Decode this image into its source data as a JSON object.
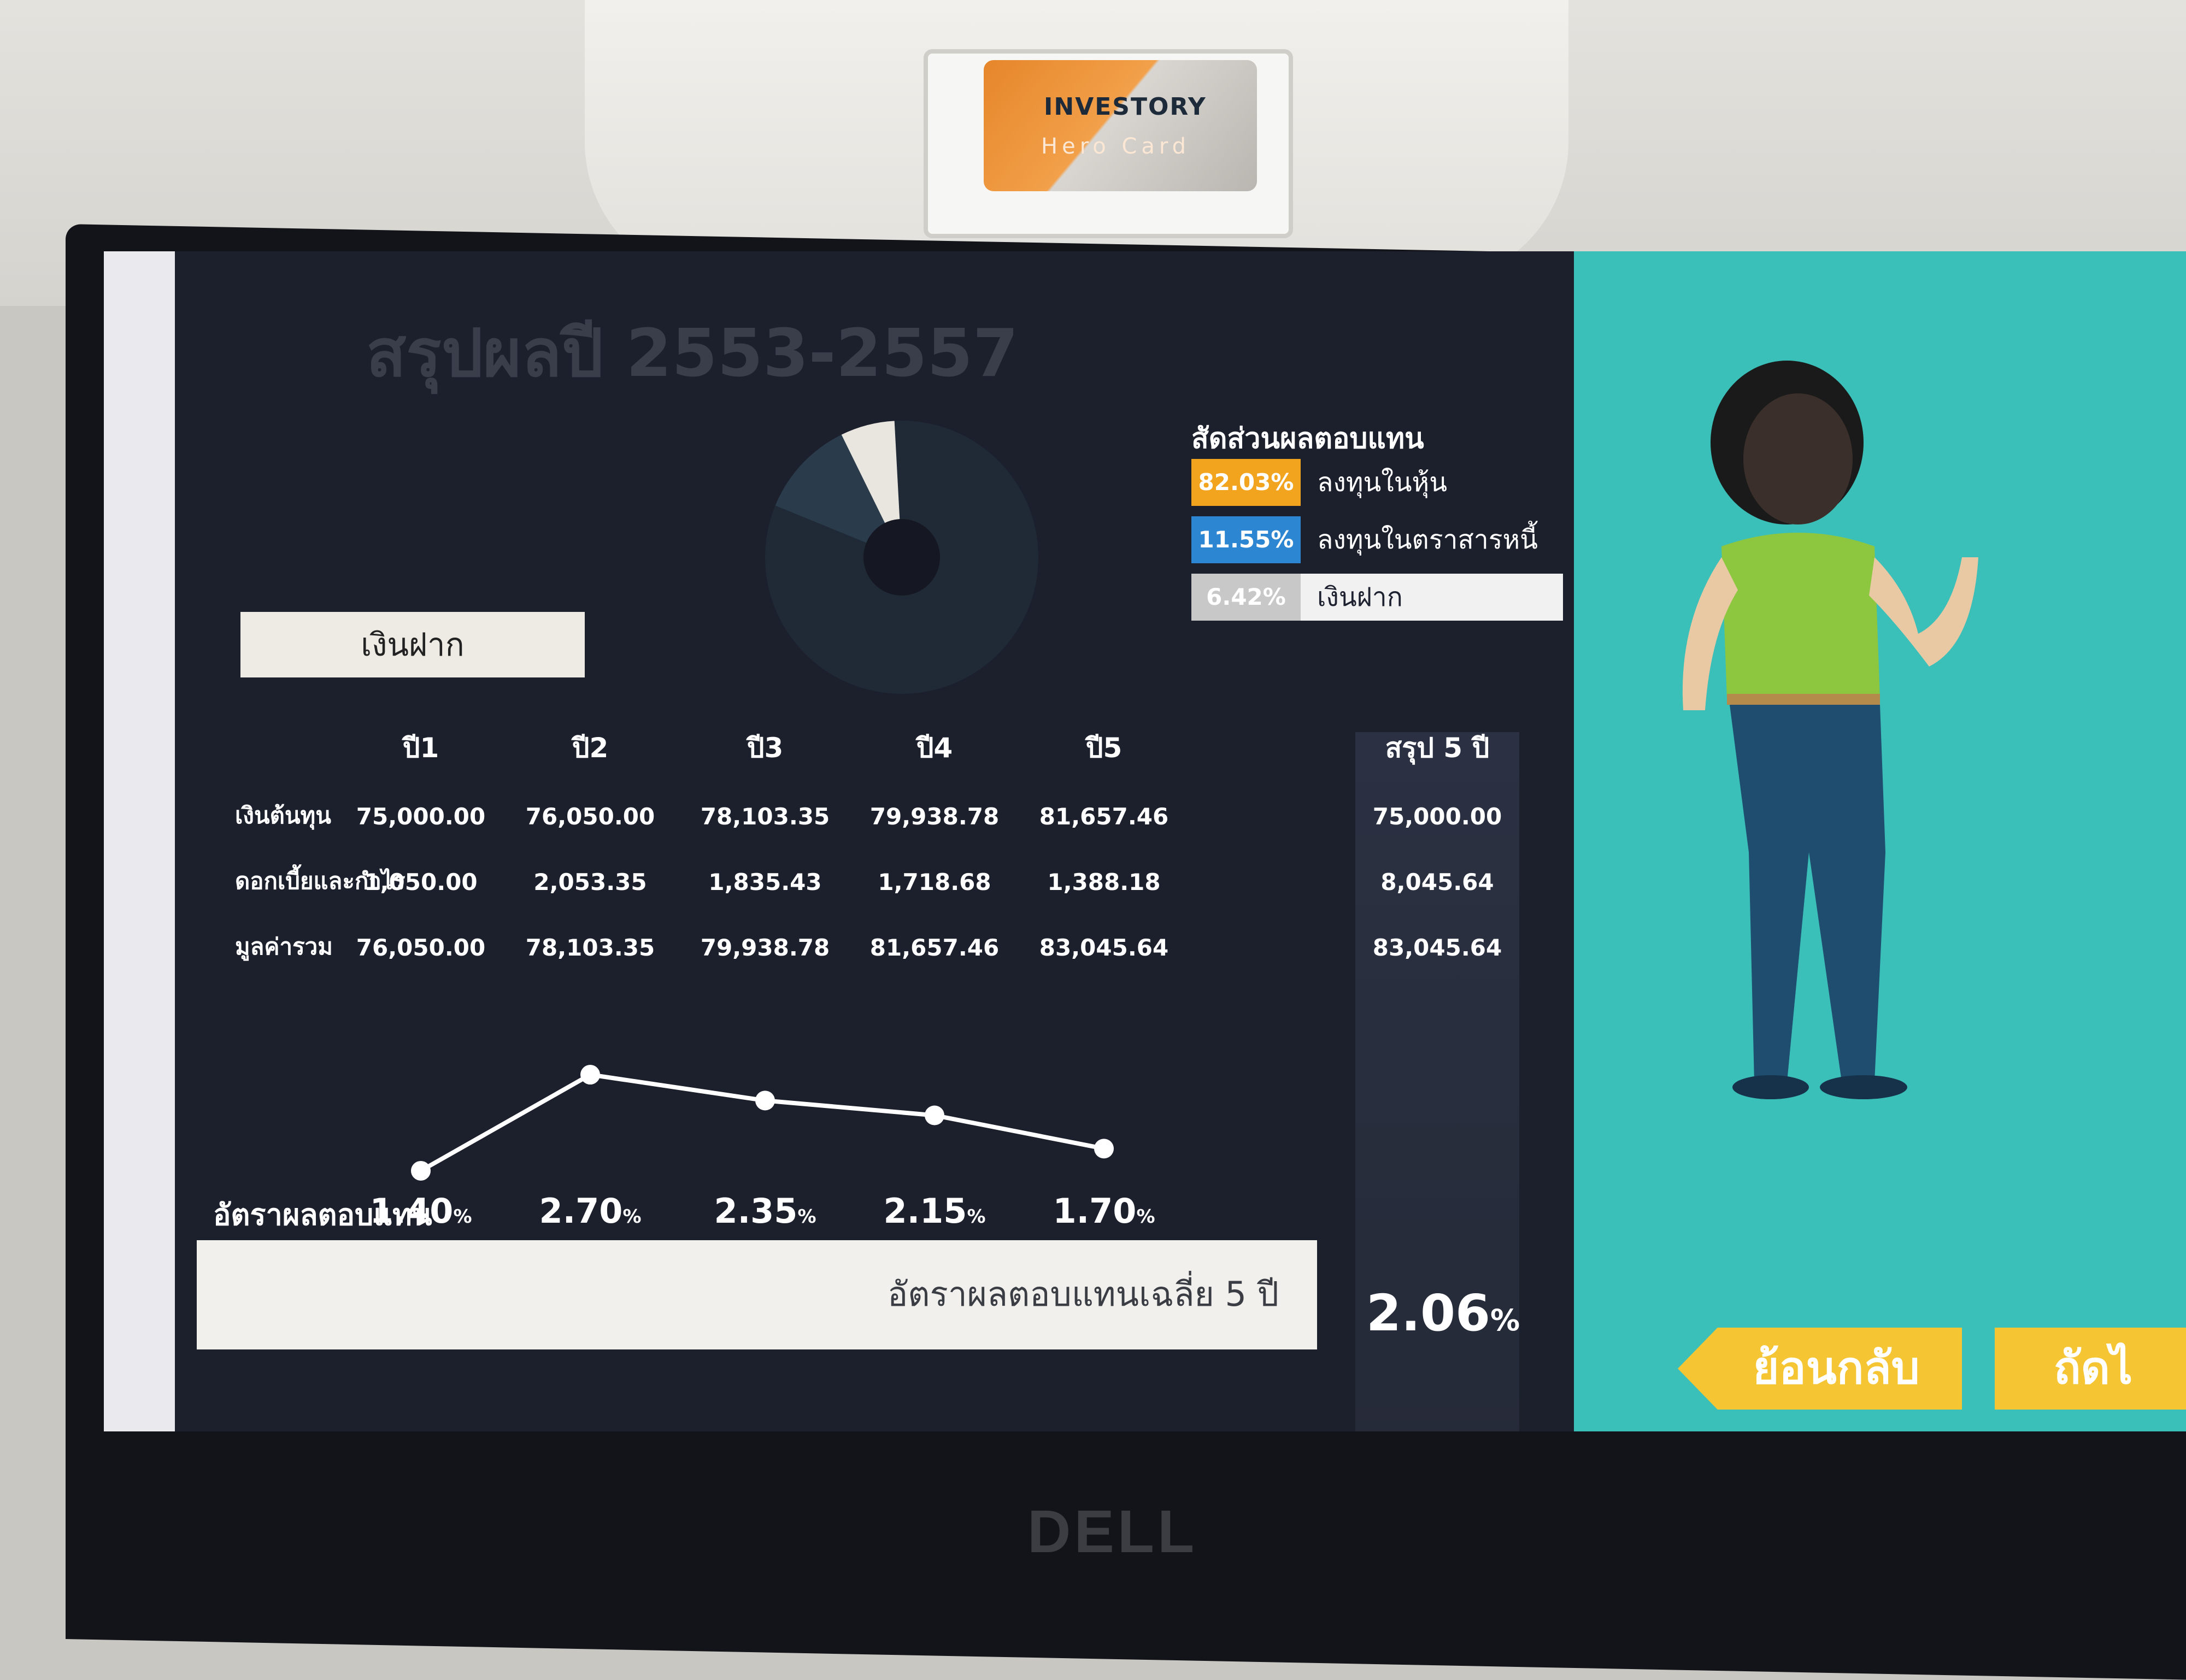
{
  "card": {
    "brand": "INVESTORY",
    "title": "Hero Card"
  },
  "monitor": {
    "brand": "DELL"
  },
  "page": {
    "title": "สรุปผลปี 2553-2557"
  },
  "legend": {
    "title": "สัดส่วนผลตอบแทน",
    "items": [
      {
        "percent": "82.03%",
        "label": "ลงทุนในหุ้น",
        "color": "#f2a41f"
      },
      {
        "percent": "11.55%",
        "label": "ลงทุนในตราสารหนี้",
        "color": "#2c86d1"
      },
      {
        "percent": "6.42%",
        "label": "เงินฝาก",
        "color": "#c8c8c8"
      }
    ]
  },
  "pie": {
    "values": [
      82.03,
      11.55,
      6.42
    ],
    "colors": [
      "#1f2a36",
      "#2a3b4c",
      "#e8e6df"
    ]
  },
  "tab": {
    "label": "เงินฝาก"
  },
  "table": {
    "columns": [
      "ปี1",
      "ปี2",
      "ปี3",
      "ปี4",
      "ปี5",
      "สรุป 5 ปี"
    ],
    "rows": [
      {
        "label": "เงินต้นทุน",
        "values": [
          "75,000.00",
          "76,050.00",
          "78,103.35",
          "79,938.78",
          "81,657.46",
          "75,000.00"
        ]
      },
      {
        "label": "ดอกเบี้ยและกำไร",
        "values": [
          "1,050.00",
          "2,053.35",
          "1,835.43",
          "1,718.68",
          "1,388.18",
          "8,045.64"
        ]
      },
      {
        "label": "มูลค่ารวม",
        "values": [
          "76,050.00",
          "78,103.35",
          "79,938.78",
          "81,657.46",
          "83,045.64",
          "83,045.64"
        ]
      }
    ]
  },
  "rates": {
    "label": "อัตราผลตอบแทน",
    "values": [
      "1.40",
      "2.70",
      "2.35",
      "2.15",
      "1.70"
    ],
    "unit": "%"
  },
  "chart_data": {
    "type": "line",
    "x": [
      "ปี1",
      "ปี2",
      "ปี3",
      "ปี4",
      "ปี5"
    ],
    "values": [
      1.4,
      2.7,
      2.35,
      2.15,
      1.7
    ]
  },
  "average": {
    "label": "อัตราผลตอบแทนเฉลี่ย 5 ปี",
    "value": "2.06",
    "unit": "%"
  },
  "nav": {
    "back": "ย้อนกลับ",
    "next": "ถัดไ"
  }
}
